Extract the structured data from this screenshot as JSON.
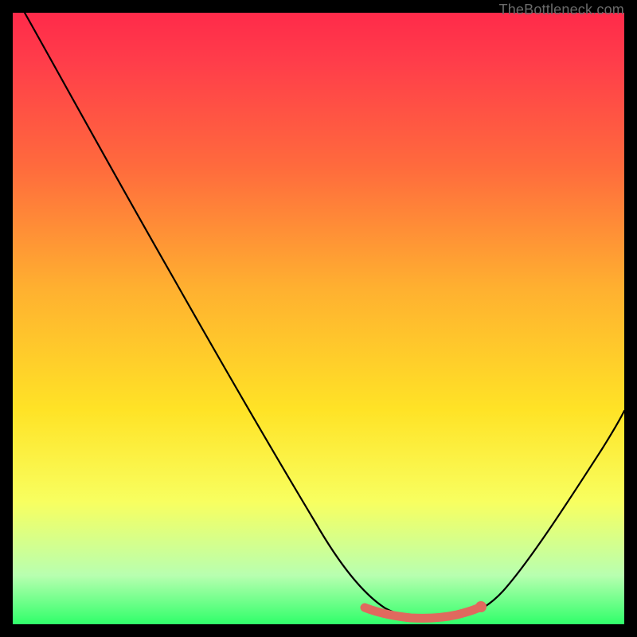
{
  "attribution": "TheBottleneck.com",
  "chart_data": {
    "type": "line",
    "title": "",
    "xlabel": "",
    "ylabel": "",
    "xlim": [
      0,
      100
    ],
    "ylim": [
      0,
      100
    ],
    "grid": false,
    "series": [
      {
        "name": "bottleneck-curve",
        "x": [
          2,
          10,
          20,
          30,
          40,
          50,
          56,
          60,
          64,
          68,
          72,
          75,
          78,
          84,
          90,
          95,
          100
        ],
        "y": [
          100,
          87,
          71,
          55,
          38,
          21,
          10,
          4,
          1,
          0,
          0,
          0,
          1,
          7,
          18,
          30,
          44
        ]
      }
    ],
    "highlight_segment": {
      "x": [
        56,
        60,
        64,
        68,
        72,
        75
      ],
      "y": [
        2.2,
        1.3,
        0.6,
        0.4,
        0.5,
        1.0
      ]
    },
    "highlight_point": {
      "x": 75,
      "y": 1.0
    }
  }
}
